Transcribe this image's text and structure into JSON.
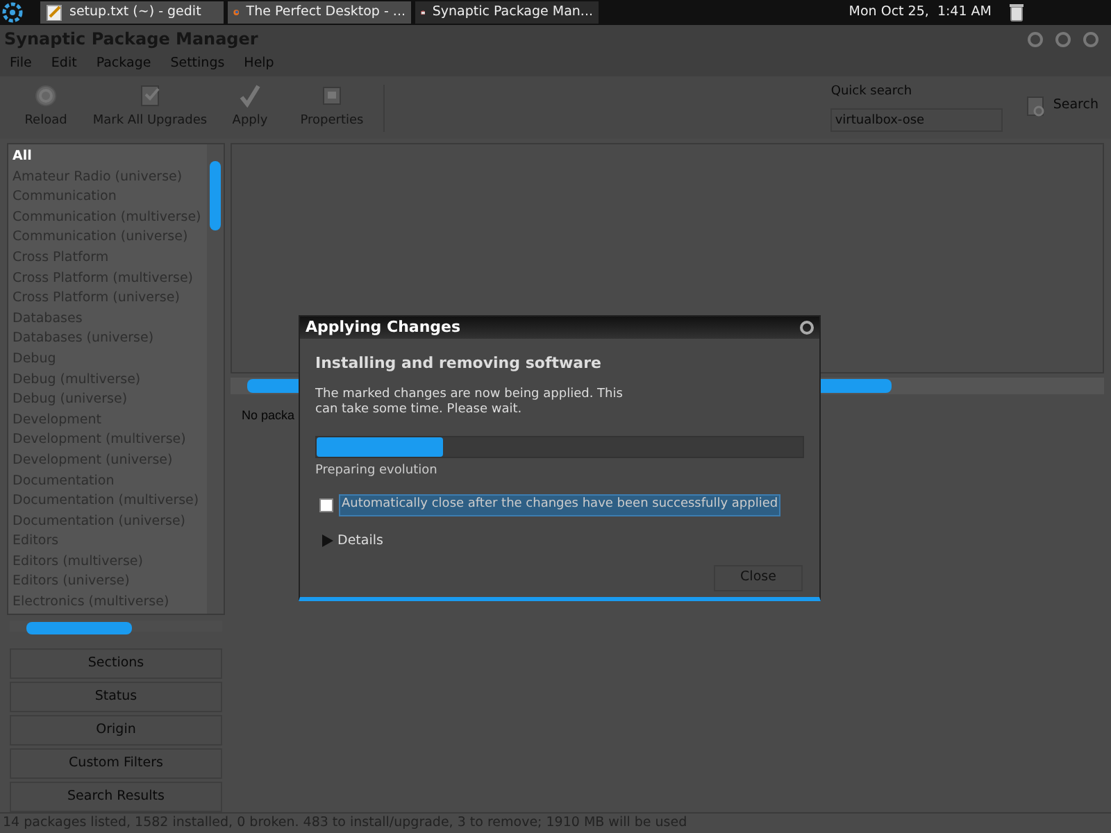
{
  "taskbar": {
    "tasks": [
      {
        "label": "setup.txt (~) - gedit",
        "kind": "editor",
        "selected": false
      },
      {
        "label": "The Perfect Desktop - ...",
        "kind": "browser",
        "selected": false
      },
      {
        "label": "Synaptic Package Man...",
        "kind": "package",
        "selected": true
      }
    ],
    "clock": "Mon Oct 25,  1:41 AM"
  },
  "window": {
    "title": "Synaptic Package Manager"
  },
  "menu": [
    "File",
    "Edit",
    "Package",
    "Settings",
    "Help"
  ],
  "toolbar": {
    "buttons": [
      {
        "label": "Reload",
        "kind": "reload"
      },
      {
        "label": "Mark All Upgrades",
        "kind": "upgrades"
      },
      {
        "label": "Apply",
        "kind": "apply"
      },
      {
        "label": "Properties",
        "kind": "properties"
      }
    ],
    "quick_search": {
      "label": "Quick search",
      "value": "virtualbox-ose"
    },
    "search_button": "Search"
  },
  "sections": [
    {
      "label": "All",
      "selected": true
    },
    {
      "label": "Amateur Radio (universe)",
      "selected": false
    },
    {
      "label": "Communication",
      "selected": false
    },
    {
      "label": "Communication (multiverse)",
      "selected": false
    },
    {
      "label": "Communication (universe)",
      "selected": false
    },
    {
      "label": "Cross Platform",
      "selected": false
    },
    {
      "label": "Cross Platform (multiverse)",
      "selected": false
    },
    {
      "label": "Cross Platform (universe)",
      "selected": false
    },
    {
      "label": "Databases",
      "selected": false
    },
    {
      "label": "Databases (universe)",
      "selected": false
    },
    {
      "label": "Debug",
      "selected": false
    },
    {
      "label": "Debug (multiverse)",
      "selected": false
    },
    {
      "label": "Debug (universe)",
      "selected": false
    },
    {
      "label": "Development",
      "selected": false
    },
    {
      "label": "Development (multiverse)",
      "selected": false
    },
    {
      "label": "Development (universe)",
      "selected": false
    },
    {
      "label": "Documentation",
      "selected": false
    },
    {
      "label": "Documentation (multiverse)",
      "selected": false
    },
    {
      "label": "Documentation (universe)",
      "selected": false
    },
    {
      "label": "Editors",
      "selected": false
    },
    {
      "label": "Editors (multiverse)",
      "selected": false
    },
    {
      "label": "Editors (universe)",
      "selected": false
    },
    {
      "label": "Electronics (multiverse)",
      "selected": false
    }
  ],
  "filter_buttons": [
    "Sections",
    "Status",
    "Origin",
    "Custom Filters",
    "Search Results"
  ],
  "description": "No packa",
  "status_bar": "14 packages listed, 1582 installed, 0 broken. 483 to install/upgrade, 3 to remove; 1910 MB will be used",
  "dialog": {
    "title": "Applying Changes",
    "heading": "Installing and removing software",
    "message": "The marked changes are now being applied. This can take some time. Please wait.",
    "progress": {
      "level": 0.26
    },
    "step": "Preparing evolution",
    "auto_close": {
      "label": "Automatically close after the changes have been successfully applied",
      "checked": false
    },
    "details": {
      "label": "Details",
      "expanded": false
    },
    "close_button": {
      "label": "Close",
      "disabled": true
    }
  }
}
